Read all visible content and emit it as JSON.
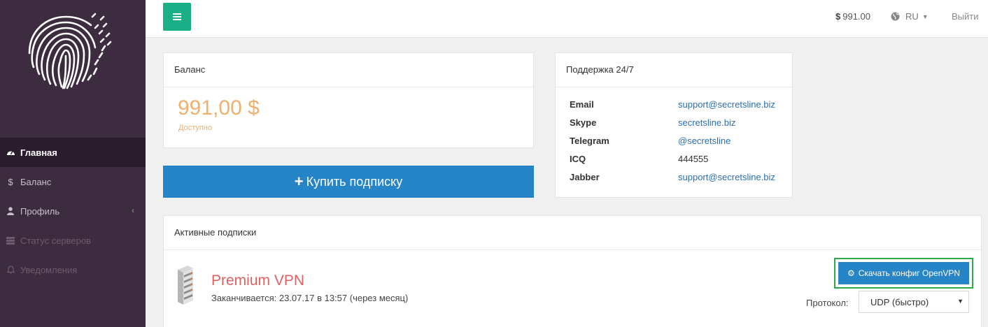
{
  "sidebar": {
    "logo_icon": "fingerprint-logo",
    "items": [
      {
        "label": "Главная",
        "icon": "dashboard-icon",
        "state": "active"
      },
      {
        "label": "Баланс",
        "icon": "dollar-icon",
        "state": "normal"
      },
      {
        "label": "Профиль",
        "icon": "user-icon",
        "state": "normal"
      },
      {
        "label": "Статус серверов",
        "icon": "server-icon",
        "state": "disabled"
      },
      {
        "label": "Уведомления",
        "icon": "bell-icon",
        "state": "disabled"
      }
    ]
  },
  "topbar": {
    "balance_symbol": "$",
    "balance_value": "991.00",
    "language": "RU",
    "logout": "Выйти"
  },
  "balance_panel": {
    "title": "Баланс",
    "amount": "991,00 $",
    "subtitle": "Доступно"
  },
  "buy_button": {
    "label": "Купить подписку"
  },
  "support_panel": {
    "title": "Поддержка 24/7",
    "rows": [
      {
        "key": "Email",
        "value": "support@secretsline.biz",
        "link": true
      },
      {
        "key": "Skype",
        "value": "secretsline.biz",
        "link": true
      },
      {
        "key": "Telegram",
        "value": "@secretsline",
        "link": true
      },
      {
        "key": "ICQ",
        "value": "444555",
        "link": false
      },
      {
        "key": "Jabber",
        "value": "support@secretsline.biz",
        "link": true
      }
    ]
  },
  "subscriptions": {
    "title": "Активные подписки",
    "items": [
      {
        "name": "Premium VPN",
        "expires": "Заканчивается: 23.07.17 в 13:57 (через месяц)",
        "download_label": "Скачать конфиг OpenVPN",
        "protocol_label": "Протокол:",
        "protocol_value": "UDP (быстро)"
      }
    ]
  },
  "colors": {
    "sidebar_bg": "#3d2b3f",
    "accent_green": "#1aaf86",
    "primary_blue": "#2585c7",
    "balance_orange": "#efb06e",
    "product_red": "#e06060",
    "highlight_green": "#2ea84a"
  }
}
